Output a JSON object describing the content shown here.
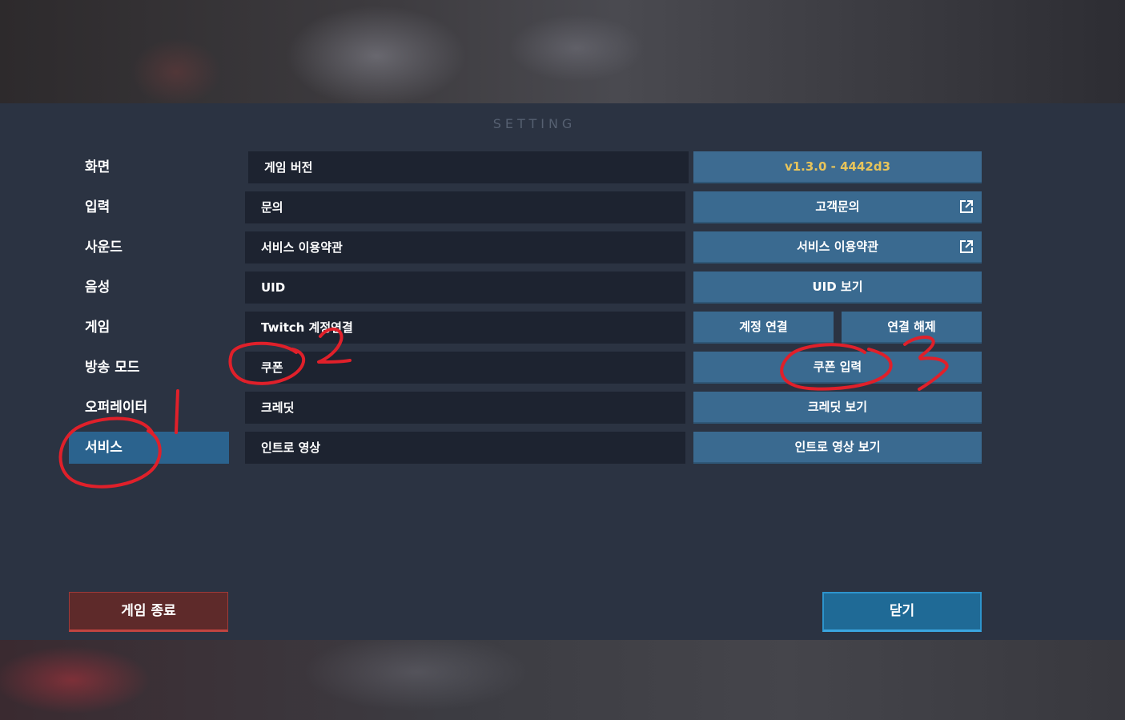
{
  "title": "SETTING",
  "sidebar": {
    "items": [
      {
        "label": "화면"
      },
      {
        "label": "입력"
      },
      {
        "label": "사운드"
      },
      {
        "label": "음성"
      },
      {
        "label": "게임"
      },
      {
        "label": "방송 모드"
      },
      {
        "label": "오퍼레이터"
      },
      {
        "label": "서비스",
        "active": true
      }
    ]
  },
  "rows": [
    {
      "label": "게임 버전",
      "value": "v1.3.0 - 4442d3"
    },
    {
      "label": "문의",
      "button": "고객문의",
      "icon": "external-link-icon"
    },
    {
      "label": "서비스 이용약관",
      "button": "서비스 이용약관",
      "icon": "external-link-icon"
    },
    {
      "label": "UID",
      "button": "UID 보기"
    },
    {
      "label": "Twitch 계정연결",
      "buttons": [
        "계정 연결",
        "연결 해제"
      ]
    },
    {
      "label": "쿠폰",
      "button": "쿠폰 입력"
    },
    {
      "label": "크레딧",
      "button": "크레딧 보기"
    },
    {
      "label": "인트로 영상",
      "button": "인트로 영상 보기"
    }
  ],
  "footer": {
    "quit_label": "게임 종료",
    "close_label": "닫기"
  },
  "colors": {
    "panel": "#2b3342",
    "active_nav": "#2b638e",
    "button": "#3a6a90",
    "version_text": "#e8c45a",
    "quit": "#5e2a2a",
    "close": "#1f6a96",
    "annotation": "#e0202a"
  },
  "annotations": [
    "1",
    "2",
    "3"
  ]
}
